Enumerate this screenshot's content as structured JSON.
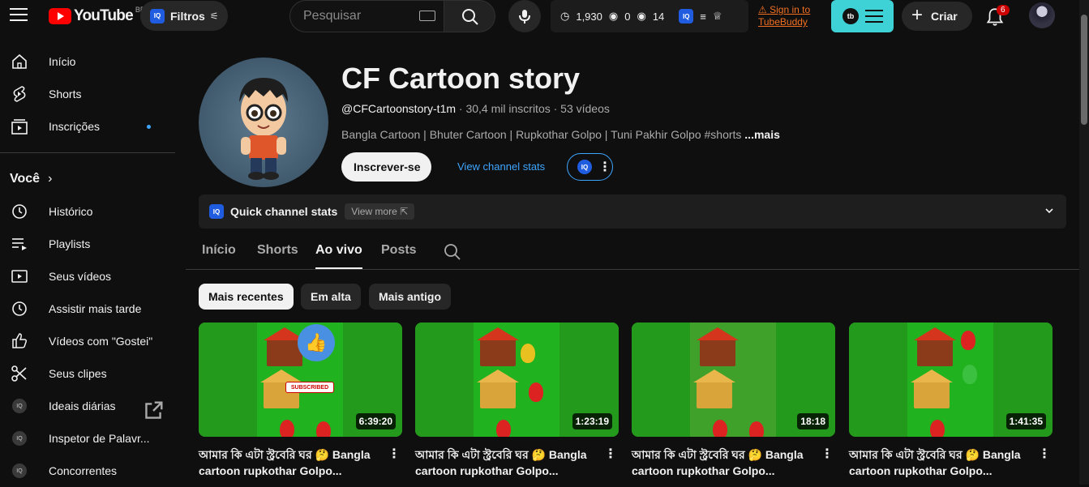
{
  "header": {
    "logo_text": "YouTube",
    "country": "BR",
    "filtros_label": "Filtros",
    "search_placeholder": "Pesquisar",
    "stat_views": "1,930",
    "stat_a": "0",
    "stat_b": "14",
    "signin_line1": "Sign in to",
    "signin_line2": "TubeBuddy",
    "tb_logo": "tb",
    "criar_label": "Criar",
    "notif_count": "6"
  },
  "sidebar": {
    "items": [
      {
        "label": "Início",
        "icon": "home-icon"
      },
      {
        "label": "Shorts",
        "icon": "shorts-icon"
      },
      {
        "label": "Inscrições",
        "icon": "subscriptions-icon"
      }
    ],
    "voce_label": "Você",
    "voce_items": [
      {
        "label": "Histórico",
        "icon": "history-icon"
      },
      {
        "label": "Playlists",
        "icon": "playlists-icon"
      },
      {
        "label": "Seus vídeos",
        "icon": "your-videos-icon"
      },
      {
        "label": "Assistir mais tarde",
        "icon": "watch-later-icon"
      },
      {
        "label": "Vídeos com \"Gostei\"",
        "icon": "like-icon"
      },
      {
        "label": "Seus clipes",
        "icon": "clips-icon"
      }
    ],
    "iq_items": [
      {
        "label": "Ideais diárias"
      },
      {
        "label": "Inspetor de Palavr..."
      },
      {
        "label": "Concorrentes"
      }
    ]
  },
  "channel": {
    "name": "CF Cartoon story",
    "handle": "@CFCartoonstory-t1m",
    "meta_rest": " · 30,4 mil inscritos · 53 vídeos",
    "desc": "Bangla Cartoon | Bhuter Cartoon | Rupkothar Golpo |  Tuni Pakhir Golpo #shorts ",
    "desc_more": "...mais",
    "subscribe_label": "Inscrever-se",
    "view_stats_label": "View channel stats",
    "quick_stats_label": "Quick channel stats",
    "view_more_label": "View more"
  },
  "tabs": [
    "Início",
    "Shorts",
    "Ao vivo",
    "Posts"
  ],
  "active_tab": "Ao vivo",
  "chips": [
    "Mais recentes",
    "Em alta",
    "Mais antigo"
  ],
  "videos": [
    {
      "duration": "6:39:20",
      "title1": "আমার কি এটা স্ট্রবেরি ঘর 🤔 Bangla",
      "title2": "cartoon rupkothar Golpo..."
    },
    {
      "duration": "1:23:19",
      "title1": "আমার কি এটা স্ট্রবেরি ঘর 🤔 Bangla",
      "title2": "cartoon rupkothar Golpo..."
    },
    {
      "duration": "18:18",
      "title1": "আমার কি এটা স্ট্রবেরি ঘর 🤔 Bangla",
      "title2": "cartoon rupkothar Golpo..."
    },
    {
      "duration": "1:41:35",
      "title1": "আমার কি এটা স্ট্রবেরি ঘর 🤔 Bangla",
      "title2": "cartoon rupkothar Golpo..."
    }
  ],
  "thumb_badge": "SUBSCRIBED",
  "colors": {
    "background": "#0f0f0f",
    "youtube_red": "#ff0000",
    "link_blue": "#3ea6ff",
    "tubebuddy": "#3ed2d7",
    "thumb_green": "#21b21f"
  }
}
